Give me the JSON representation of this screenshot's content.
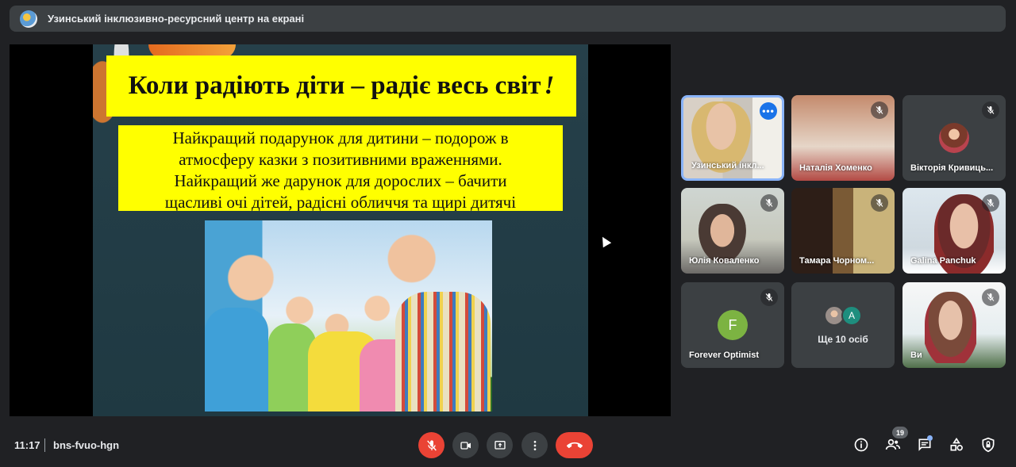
{
  "window": {
    "title": "Узинський інклюзивно-ресурсний центр на екрані"
  },
  "slide": {
    "title": "Коли радіють діти – радіє весь світ",
    "title_mark": "!",
    "body_lines": [
      "Найкращий подарунок для дитини – подорож в",
      "атмосферу казки з позитивними враженнями.",
      "Найкращий же дарунок для дорослих – бачити",
      "щасливі очі дітей, радісні обличчя та щирі дитячі"
    ]
  },
  "participants": [
    {
      "name": "Узинський інкл...",
      "muted": false,
      "has_menu": true
    },
    {
      "name": "Наталія Хоменко",
      "muted": true
    },
    {
      "name": "Вікторія Кривиць...",
      "muted": true
    },
    {
      "name": "Юлія Коваленко",
      "muted": true
    },
    {
      "name": "Тамара Чорном...",
      "muted": true
    },
    {
      "name": "Galina Panchuk",
      "muted": true
    },
    {
      "name": "Forever Optimist",
      "muted": true,
      "initial": "F",
      "avatar_color": "#7cb342"
    },
    {
      "name": "Ще 10 осіб",
      "initial": "A",
      "avatar_color": "#1e8e7e"
    },
    {
      "name": "Ви",
      "muted": true
    }
  ],
  "bottom": {
    "time": "11:17",
    "meeting_code": "bns-fvuo-hgn",
    "people_count": "19"
  },
  "colors": {
    "background": "#202124",
    "surface": "#3c4043",
    "danger": "#ea4335",
    "accent": "#8ab4f8",
    "slide_highlight": "#ffff00"
  },
  "icons": {
    "mic_off": "mic-off-icon",
    "camera": "camera-icon",
    "present": "present-icon",
    "more": "more-vert-icon",
    "hangup": "hangup-icon",
    "info": "info-icon",
    "people": "people-icon",
    "chat": "chat-icon",
    "activities": "activities-icon",
    "host_controls": "shield-icon"
  }
}
